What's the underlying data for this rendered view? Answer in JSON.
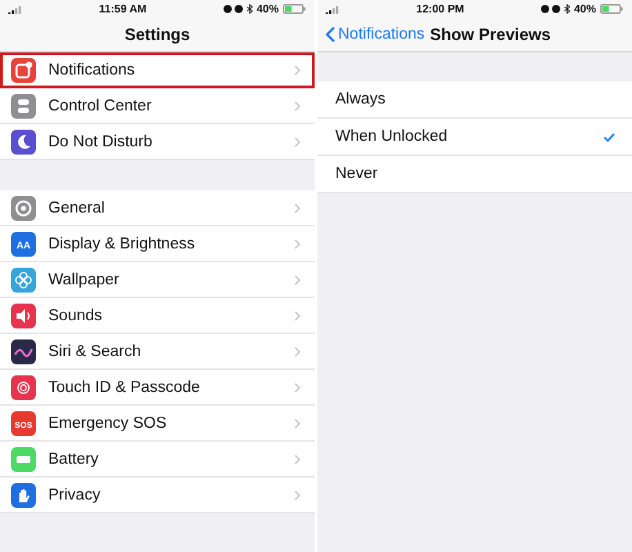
{
  "screens": [
    {
      "status_bar": {
        "time": "11:59 AM",
        "battery": "40%"
      },
      "nav": {
        "title": "Settings"
      },
      "groups": [
        [
          {
            "label": "Notifications",
            "kind": "notifications",
            "color": "#e8423a",
            "highlighted": true
          },
          {
            "label": "Control Center",
            "kind": "control",
            "color": "#8e8e93",
            "highlighted": false
          },
          {
            "label": "Do Not Disturb",
            "kind": "moon",
            "color": "#5a4fcf",
            "highlighted": false
          }
        ],
        [
          {
            "label": "General",
            "kind": "gear",
            "color": "#8e8e93",
            "highlighted": false
          },
          {
            "label": "Display & Brightness",
            "kind": "text",
            "icon_text": "AA",
            "color": "#1e6fe0",
            "highlighted": false
          },
          {
            "label": "Wallpaper",
            "kind": "flower",
            "color": "#36a6d8",
            "highlighted": false
          },
          {
            "label": "Sounds",
            "kind": "speaker",
            "color": "#e8334f",
            "highlighted": false
          },
          {
            "label": "Siri & Search",
            "kind": "siri",
            "color": "#2a2a48",
            "highlighted": false
          },
          {
            "label": "Touch ID & Passcode",
            "kind": "fingerprint",
            "color": "#e8334f",
            "highlighted": false
          },
          {
            "label": "Emergency SOS",
            "kind": "text",
            "icon_text": "SOS",
            "color": "#e8392f",
            "highlighted": false
          },
          {
            "label": "Battery",
            "kind": "battery",
            "color": "#4cd964",
            "highlighted": false
          },
          {
            "label": "Privacy",
            "kind": "hand",
            "color": "#1e6fe0",
            "highlighted": false
          }
        ]
      ]
    },
    {
      "status_bar": {
        "time": "12:00 PM",
        "battery": "40%"
      },
      "nav": {
        "back": "Notifications",
        "title": "Show Previews"
      },
      "options": [
        {
          "label": "Always",
          "selected": false
        },
        {
          "label": "When Unlocked",
          "selected": true
        },
        {
          "label": "Never",
          "selected": false
        }
      ]
    }
  ]
}
